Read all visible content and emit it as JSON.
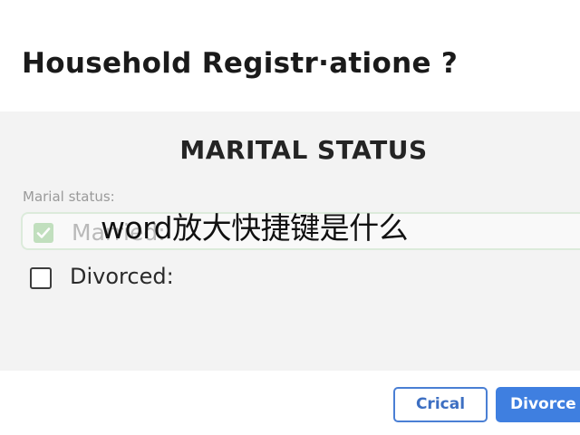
{
  "dialog": {
    "title": "Household Registr·atione ?"
  },
  "section": {
    "heading": "MARITAL STATUS",
    "field_label": "Marial status:"
  },
  "options": [
    {
      "label": "Married:",
      "checked": true
    },
    {
      "label": "Divorced:",
      "checked": false
    }
  ],
  "overlay": {
    "caption": "word放大快捷键是什么"
  },
  "buttons": {
    "cancel_label": "Crical",
    "confirm_label": "Divorce"
  },
  "colors": {
    "accent": "#3f7fe0",
    "check_fill": "#b9dcb5",
    "panel_bg": "#f3f3f3"
  }
}
